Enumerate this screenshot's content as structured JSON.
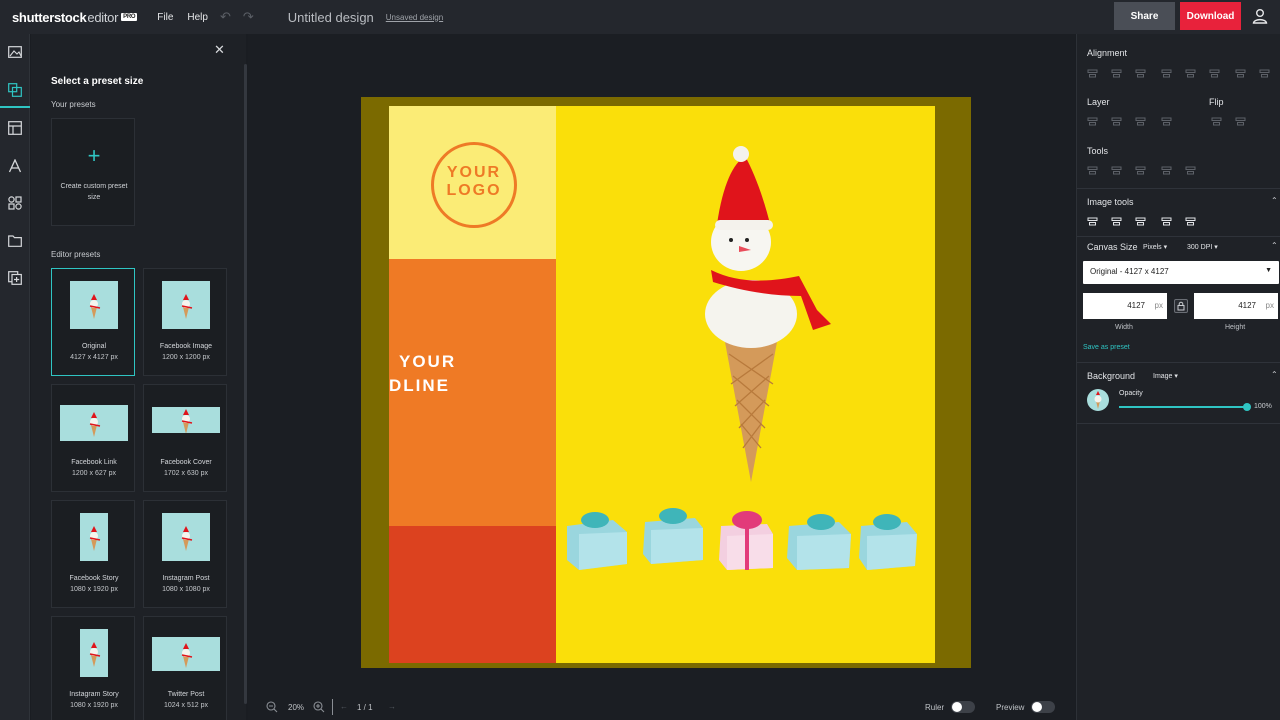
{
  "topbar": {
    "brand": "shutterstock",
    "brand_suffix": "editor",
    "brand_badge": "PRO",
    "menu_file": "File",
    "menu_help": "Help",
    "doc_title": "Untitled design",
    "unsaved": "Unsaved design",
    "share": "Share",
    "download": "Download"
  },
  "panel": {
    "title": "Select a preset size",
    "your_presets": "Your presets",
    "create_custom": "Create custom preset size",
    "editor_presets": "Editor presets",
    "presets": [
      {
        "name": "Original",
        "size": "4127 x 4127 px"
      },
      {
        "name": "Facebook Image",
        "size": "1200 x 1200 px"
      },
      {
        "name": "Facebook Link",
        "size": "1200 x 627 px"
      },
      {
        "name": "Facebook Cover",
        "size": "1702 x 630 px"
      },
      {
        "name": "Facebook Story",
        "size": "1080 x 1920 px"
      },
      {
        "name": "Instagram Post",
        "size": "1080 x 1080 px"
      },
      {
        "name": "Instagram Story",
        "size": "1080 x 1920 px"
      },
      {
        "name": "Twitter Post",
        "size": "1024 x 512 px"
      }
    ]
  },
  "canvas": {
    "logo_line1": "YOUR",
    "logo_line2": "LOGO",
    "headline_line1": "YOUR",
    "headline_line2": "DLINE"
  },
  "bottombar": {
    "zoom": "20%",
    "page": "1 / 1",
    "ruler": "Ruler",
    "preview": "Preview"
  },
  "rightpanel": {
    "alignment": "Alignment",
    "layer": "Layer",
    "flip": "Flip",
    "tools": "Tools",
    "image_tools": "Image tools",
    "canvas_size": "Canvas Size",
    "unit": "Pixels",
    "dpi_value": "300",
    "dpi_label": "DPI",
    "size_preset": "Original - 4127 x 4127",
    "width_value": "4127",
    "height_value": "4127",
    "px": "px",
    "width_label": "Width",
    "height_label": "Height",
    "save_as_preset": "Save as preset",
    "background": "Background",
    "background_type": "Image",
    "opacity": "Opacity",
    "opacity_value": "100%"
  },
  "colors": {
    "accent": "#2fc5c3",
    "download": "#e8223b",
    "artboard": "#fadf0a",
    "orange": "#ef7a25"
  }
}
